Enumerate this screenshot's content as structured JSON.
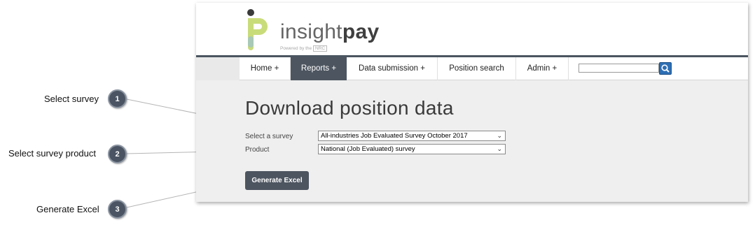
{
  "callouts": [
    {
      "label": "Select survey",
      "number": "1"
    },
    {
      "label": "Select survey product",
      "number": "2"
    },
    {
      "label": "Generate Excel",
      "number": "3"
    }
  ],
  "brand": {
    "name_light": "insight",
    "name_bold": "pay",
    "powered_prefix": "Powered by the",
    "powered_org": "NRC",
    "colors": {
      "accent_green": "#b7d77a",
      "accent_teal": "#4fb3a3",
      "nav_dark": "#4d5560"
    }
  },
  "nav": {
    "items": [
      {
        "label": "Home +"
      },
      {
        "label": "Reports +",
        "active": true
      },
      {
        "label": "Data submission +"
      },
      {
        "label": "Position search"
      },
      {
        "label": "Admin +"
      }
    ],
    "search": {
      "value": "",
      "icon": "search-icon"
    }
  },
  "page": {
    "title": "Download position data",
    "fields": [
      {
        "label": "Select a survey",
        "value": "All-industries Job Evaluated Survey October 2017"
      },
      {
        "label": "Product",
        "value": "National (Job Evaluated) survey"
      }
    ],
    "generate_button": "Generate Excel"
  }
}
